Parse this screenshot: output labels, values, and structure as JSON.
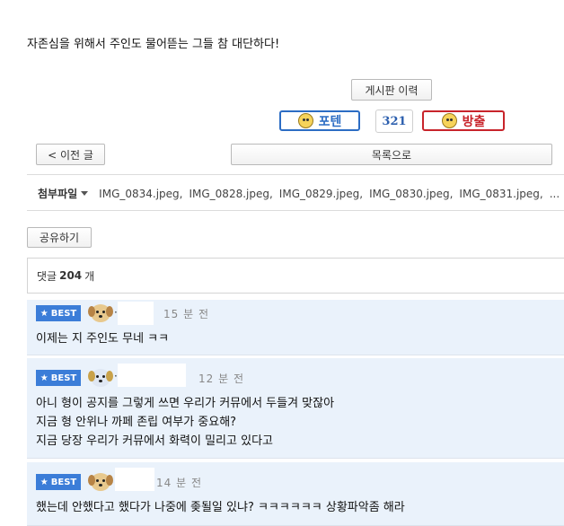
{
  "post": {
    "body_text": "자존심을 위해서 주인도 물어뜯는 그들 참 대단하다!"
  },
  "controls": {
    "history_label": "게시판 이력",
    "poten_label": "포텐",
    "count_value": "321",
    "bang_label": "방출",
    "prev_label": "< 이전 글",
    "list_label": "목록으로",
    "share_label": "공유하기"
  },
  "attachments": {
    "label": "첨부파일",
    "files": [
      "IMG_0834.jpeg,",
      "IMG_0828.jpeg,",
      "IMG_0829.jpeg,",
      "IMG_0830.jpeg,",
      "IMG_0831.jpeg,",
      "..."
    ]
  },
  "comments_header": {
    "prefix": "댓글",
    "count": "204",
    "suffix": "개"
  },
  "comments": [
    {
      "badge": "BEST",
      "author_suffix": "·",
      "time": "15 분 전",
      "lines": [
        "이제는 지 주인도 무네 ㅋㅋ"
      ]
    },
    {
      "badge": "BEST",
      "author_suffix": "·",
      "time": "12 분 전",
      "lines": [
        "아니 형이 공지를 그렇게 쓰면 우리가 커뮤에서 두들겨 맞잖아",
        "지금 형 안위나 까페 존립 여부가 중요해?",
        "지금 당장 우리가 커뮤에서 화력이 밀리고 있다고"
      ]
    },
    {
      "badge": "BEST",
      "author_suffix": "",
      "time": "14 분 전",
      "lines": [
        "했는데 안했다고 했다가 나중에 좆될일 있냐? ㅋㅋㅋㅋㅋㅋ 상황파악좀 해라"
      ]
    }
  ],
  "colors": {
    "best_badge": "#3b7dd8",
    "comment_bg": "#eaf2fb",
    "poten": "#2c6dc4",
    "bang": "#c8242b"
  },
  "icons": {
    "best": "star-icon",
    "attach_toggle": "caret-down-icon",
    "avatar": "dog-avatar-icon"
  }
}
